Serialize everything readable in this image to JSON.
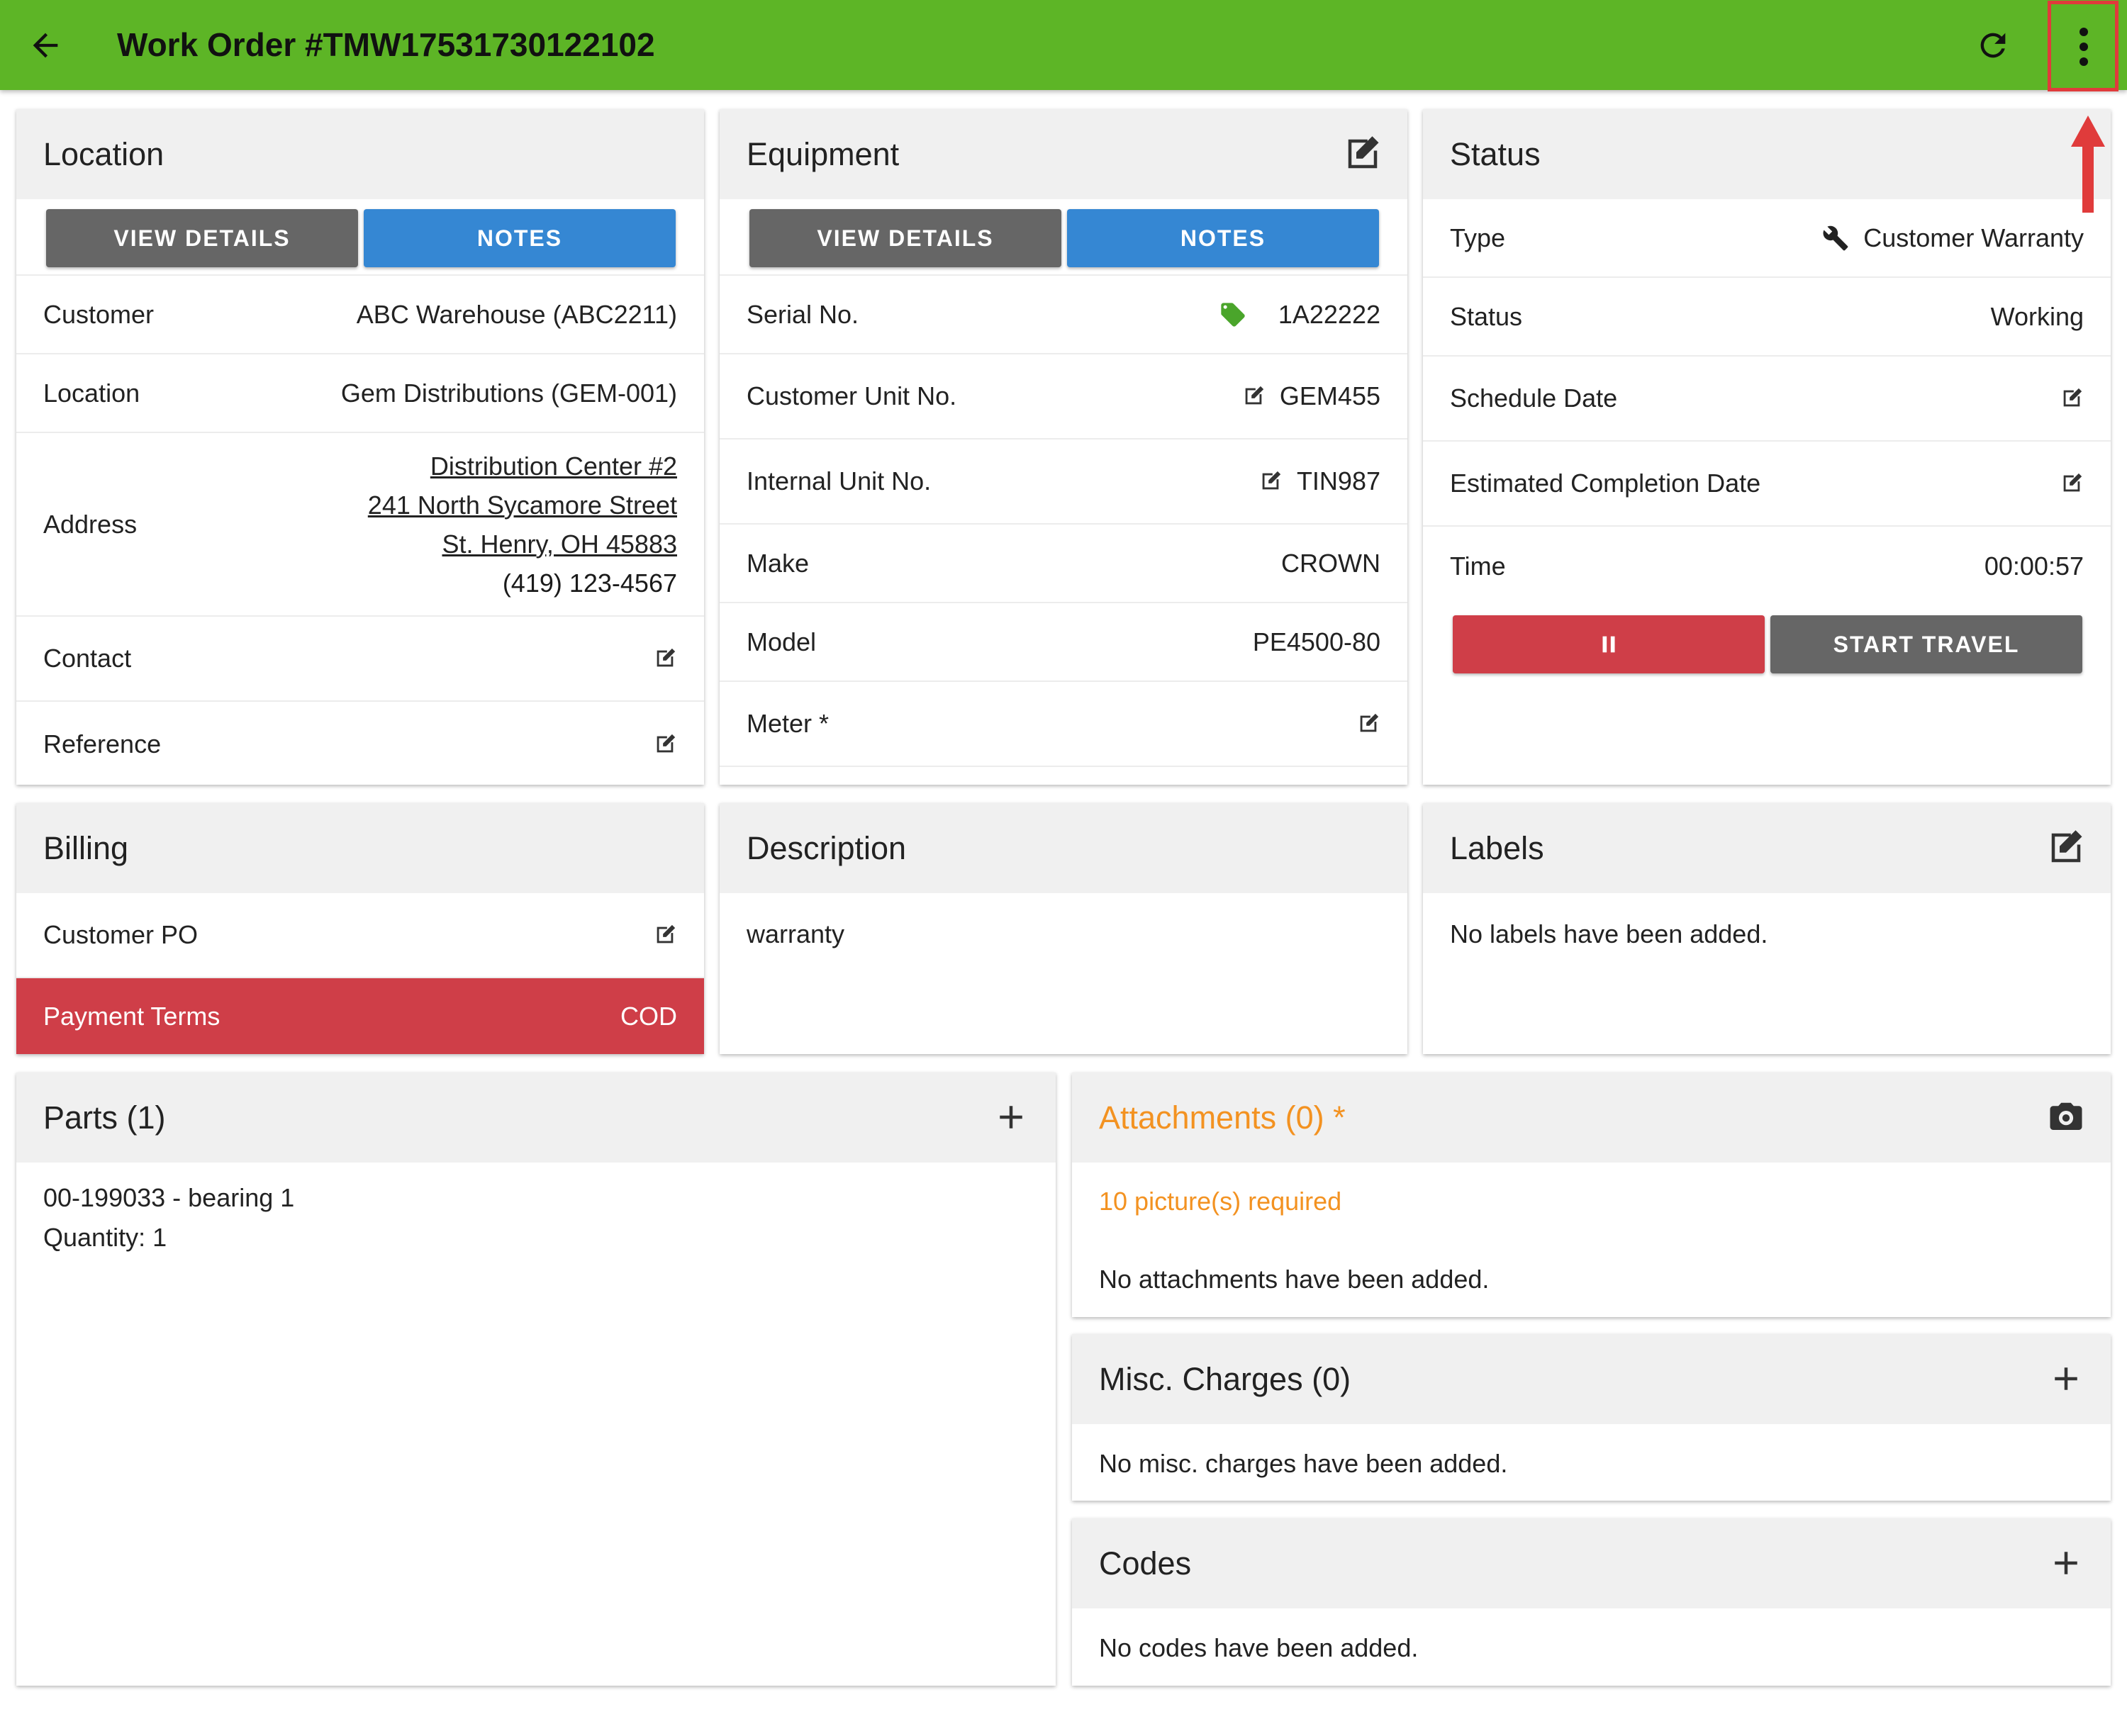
{
  "header": {
    "title": "Work Order #TMW17531730122102",
    "back_icon": "arrow-left-icon",
    "refresh_icon": "refresh-icon",
    "more_icon": "more-vertical-icon",
    "accent": "#5db526"
  },
  "location": {
    "title": "Location",
    "view_details": "VIEW DETAILS",
    "notes": "NOTES",
    "customer_label": "Customer",
    "customer_value": "ABC Warehouse (ABC2211)",
    "location_label": "Location",
    "location_value": "Gem Distributions (GEM-001)",
    "address_label": "Address",
    "address_line1": "Distribution Center #2",
    "address_line2": "241 North Sycamore Street",
    "address_line3": "St. Henry, OH 45883",
    "phone": "(419) 123-4567",
    "contact_label": "Contact",
    "reference_label": "Reference"
  },
  "equipment": {
    "title": "Equipment",
    "view_details": "VIEW DETAILS",
    "notes": "NOTES",
    "serial_label": "Serial No.",
    "serial_value": "1A22222",
    "customer_unit_label": "Customer Unit No.",
    "customer_unit_value": "GEM455",
    "internal_unit_label": "Internal Unit No.",
    "internal_unit_value": "TIN987",
    "make_label": "Make",
    "make_value": "CROWN",
    "model_label": "Model",
    "model_value": "PE4500-80",
    "meter_label": "Meter *"
  },
  "status": {
    "title": "Status",
    "type_label": "Type",
    "type_value": "Customer Warranty",
    "status_label": "Status",
    "status_value": "Working",
    "schedule_label": "Schedule Date",
    "est_completion_label": "Estimated Completion Date",
    "time_label": "Time",
    "time_value": "00:00:57",
    "start_travel": "START TRAVEL"
  },
  "billing": {
    "title": "Billing",
    "customer_po_label": "Customer PO",
    "payment_terms_label": "Payment Terms",
    "payment_terms_value": "COD"
  },
  "description": {
    "title": "Description",
    "text": "warranty"
  },
  "labels": {
    "title": "Labels",
    "empty": "No labels have been added."
  },
  "parts": {
    "title": "Parts (1)",
    "item_line1": "00-199033 - bearing 1",
    "item_line2": "Quantity: 1"
  },
  "attachments": {
    "title": "Attachments (0) *",
    "required": "10 picture(s) required",
    "empty": "No attachments have been added."
  },
  "misc": {
    "title": "Misc. Charges (0)",
    "empty": "No misc. charges have been added."
  },
  "codes": {
    "title": "Codes",
    "empty": "No codes have been added."
  }
}
